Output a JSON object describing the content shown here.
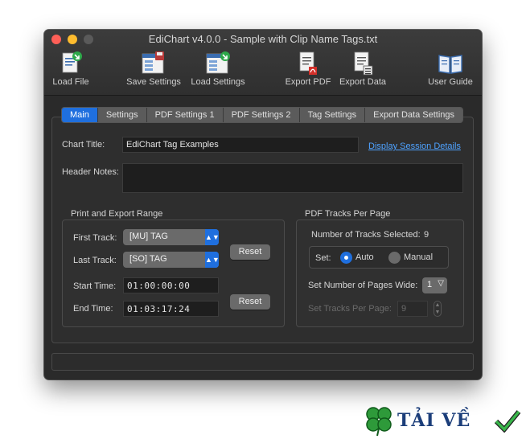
{
  "window": {
    "title": "EdiChart v4.0.0 - Sample with Clip Name Tags.txt"
  },
  "toolbar": {
    "load_file": "Load File",
    "save_settings": "Save Settings",
    "load_settings": "Load Settings",
    "export_pdf": "Export PDF",
    "export_data": "Export Data",
    "user_guide": "User Guide"
  },
  "tabs": [
    "Main",
    "Settings",
    "PDF Settings 1",
    "PDF Settings 2",
    "Tag Settings",
    "Export Data Settings"
  ],
  "main": {
    "chart_title_label": "Chart Title:",
    "chart_title_value": "EdiChart Tag Examples",
    "display_session_link": "Display Session Details",
    "header_notes_label": "Header Notes:",
    "header_notes_value": ""
  },
  "range": {
    "title": "Print and Export Range",
    "first_track_label": "First Track:",
    "first_track_value": "[MU] TAG",
    "last_track_label": "Last Track:",
    "last_track_value": "[SO] TAG",
    "reset_label": "Reset",
    "start_time_label": "Start Time:",
    "start_time_value": "01:00:00:00",
    "end_time_label": "End Time:",
    "end_time_value": "01:03:17:24",
    "reset2_label": "Reset"
  },
  "pdf_tracks": {
    "title": "PDF Tracks Per Page",
    "num_selected_label": "Number of Tracks Selected:",
    "num_selected_value": "9",
    "set_label": "Set:",
    "auto_label": "Auto",
    "manual_label": "Manual",
    "selected_mode": "Auto",
    "pages_wide_label": "Set Number of Pages Wide:",
    "pages_wide_value": "1",
    "tracks_per_page_label": "Set Tracks Per Page:",
    "tracks_per_page_value": "9"
  },
  "watermark": {
    "text": "TẢI VỀ"
  },
  "colors": {
    "accent": "#1f6fde",
    "link": "#4ea2ff",
    "window_bg": "#2a2a2a"
  }
}
